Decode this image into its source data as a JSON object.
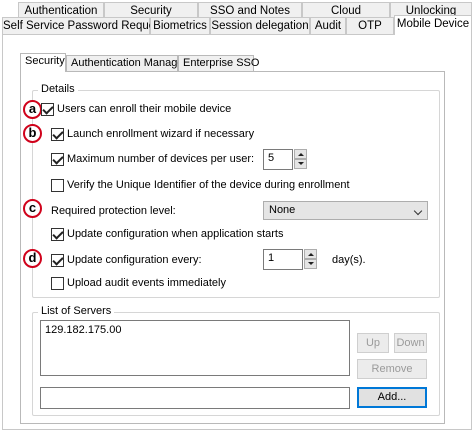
{
  "outer_tabs_row1": [
    "Authentication",
    "Security",
    "SSO and Notes",
    "Cloud",
    "Unlocking"
  ],
  "outer_tabs_row2": [
    "Self Service Password Request",
    "Biometrics",
    "Session delegation",
    "Audit",
    "OTP",
    "Mobile Device"
  ],
  "inner_tabs": [
    "Security",
    "Authentication Manager",
    "Enterprise SSO"
  ],
  "details": {
    "title": "Details",
    "markers": [
      "a",
      "b",
      "c",
      "d"
    ],
    "enroll_label": "Users can enroll their mobile device",
    "wizard_label": "Launch enrollment wizard if necessary",
    "max_devices_label": "Maximum number of devices per user:",
    "max_devices_value": "5",
    "verify_label": "Verify the Unique Identifier of the device during enrollment",
    "protection_label": "Required protection level:",
    "protection_value": "None",
    "update_start_label": "Update configuration when application starts",
    "update_every_label": "Update configuration every:",
    "update_every_value": "1",
    "days_label": "day(s).",
    "upload_label": "Upload audit events immediately"
  },
  "checks": {
    "enroll": true,
    "wizard": true,
    "max_devices": true,
    "verify": false,
    "update_start": true,
    "update_every": true,
    "upload": false
  },
  "servers": {
    "title": "List of Servers",
    "items": [
      "129.182.175.00"
    ],
    "up_label": "Up",
    "down_label": "Down",
    "remove_label": "Remove",
    "add_label": "Add...",
    "new_server_value": ""
  },
  "colors": {
    "marker_border": "#d0021b",
    "focus_border": "#0078d7"
  }
}
